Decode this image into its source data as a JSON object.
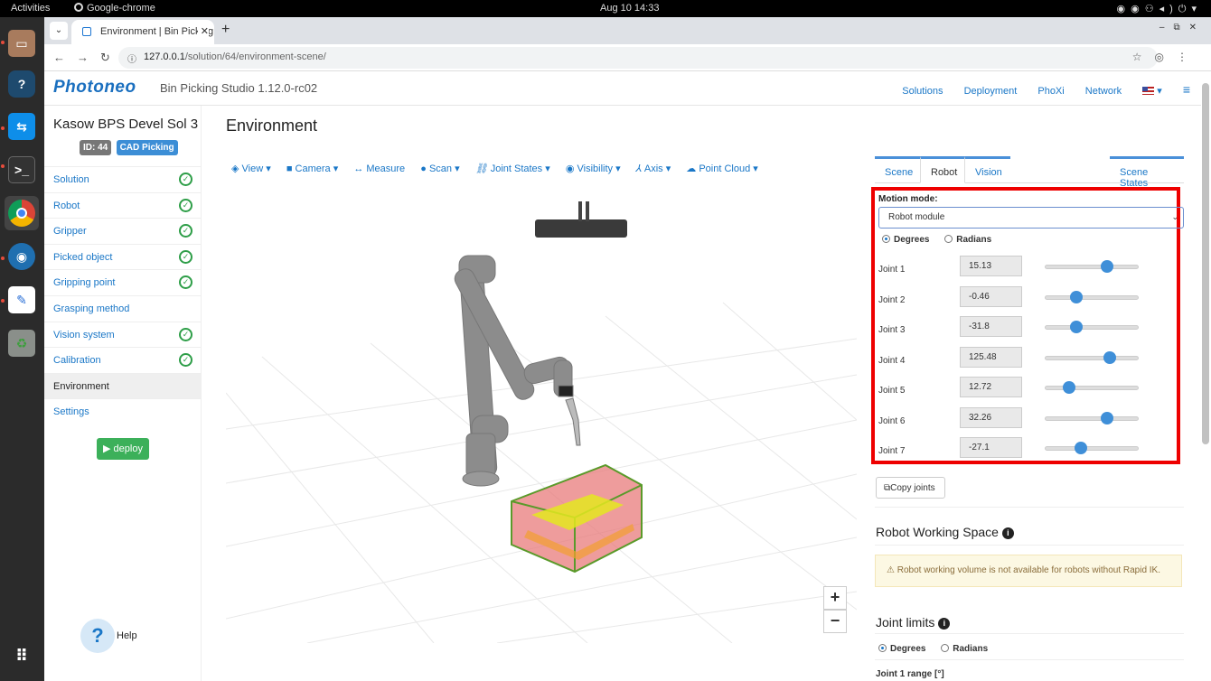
{
  "os": {
    "activities": "Activities",
    "app_name": "Google-chrome",
    "clock": "Aug 10  14:33"
  },
  "browser": {
    "tab_title": "Environment | Bin Picking",
    "url_host": "127.0.0.1",
    "url_path": "/solution/64/environment-scene/"
  },
  "nav": {
    "logo": "Photoneo",
    "version": "Bin Picking Studio 1.12.0-rc02",
    "menu": [
      "Solutions",
      "Deployment",
      "PhoXi",
      "Network"
    ]
  },
  "sidebar": {
    "solution_name": "Kasow BPS Devel Sol 3",
    "id_badge": "ID: 44",
    "type_badge": "CAD Picking",
    "items": [
      {
        "label": "Solution",
        "done": true
      },
      {
        "label": "Robot",
        "done": true
      },
      {
        "label": "Gripper",
        "done": true
      },
      {
        "label": "Picked object",
        "done": true
      },
      {
        "label": "Gripping point",
        "done": true
      },
      {
        "label": "Grasping method",
        "done": false
      },
      {
        "label": "Vision system",
        "done": true
      },
      {
        "label": "Calibration",
        "done": true
      },
      {
        "label": "Environment",
        "done": false
      },
      {
        "label": "Settings",
        "done": false
      }
    ],
    "deploy_label": "deploy",
    "help_label": "Help"
  },
  "main": {
    "heading": "Environment",
    "toolbar": [
      "View",
      "Camera",
      "Measure",
      "Scan",
      "Joint States",
      "Visibility",
      "Axis",
      "Point Cloud"
    ],
    "zoom_in": "+",
    "zoom_out": "−"
  },
  "panel": {
    "tabs": [
      "Scene",
      "Robot",
      "Vision",
      "Scene States"
    ],
    "active_tab": "Robot",
    "motion_mode_label": "Motion mode:",
    "motion_mode_value": "Robot module",
    "unit_degrees": "Degrees",
    "unit_radians": "Radians",
    "joints": [
      {
        "label": "Joint 1",
        "value": "15.13",
        "slider": 0.67
      },
      {
        "label": "Joint 2",
        "value": "-0.46",
        "slider": 0.33
      },
      {
        "label": "Joint 3",
        "value": "-31.8",
        "slider": 0.33
      },
      {
        "label": "Joint 4",
        "value": "125.48",
        "slider": 0.7
      },
      {
        "label": "Joint 5",
        "value": "12.72",
        "slider": 0.25
      },
      {
        "label": "Joint 6",
        "value": "32.26",
        "slider": 0.67
      },
      {
        "label": "Joint 7",
        "value": "-27.1",
        "slider": 0.38
      }
    ],
    "copy_joints": "Copy joints",
    "rws_heading": "Robot Working Space",
    "rws_warning": "Robot working volume is not available for robots without Rapid IK.",
    "joint_limits_heading": "Joint limits",
    "joint1_range": "Joint 1 range [°]"
  }
}
